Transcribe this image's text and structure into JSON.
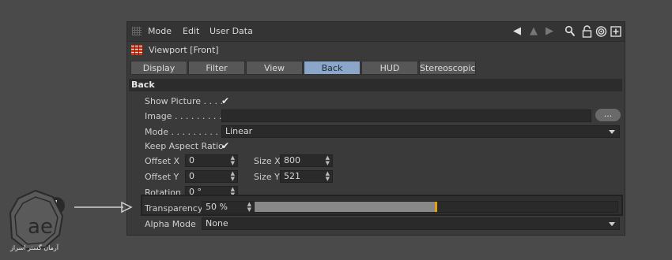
{
  "menubar": {
    "items": [
      "Mode",
      "Edit",
      "User Data"
    ]
  },
  "title": "Viewport [Front]",
  "tabs": [
    "Display",
    "Filter",
    "View",
    "Back",
    "HUD",
    "Stereoscopic"
  ],
  "active_tab": "Back",
  "section": "Back",
  "fields": {
    "show_picture": "Show Picture . . . .",
    "image": "Image . . . . . . . . . .",
    "image_browse": "...",
    "mode": "Mode . . . . . . . . . .",
    "mode_value": "Linear",
    "keep_aspect": "Keep Aspect Ratio",
    "offset_x": "Offset X",
    "offset_x_value": "0",
    "offset_y": "Offset Y",
    "offset_y_value": "0",
    "size_x": "Size X",
    "size_x_value": "800",
    "size_y": "Size Y",
    "size_y_value": "521",
    "rotation": "Rotation",
    "rotation_value": "0 °",
    "transparency": "Transparency",
    "transparency_value": "50 %",
    "transparency_level": 0.5,
    "alpha_mode": "Alpha Mode",
    "alpha_mode_value": "None"
  },
  "checkmark": "✔",
  "callout": "1",
  "watermark": {
    "logo_text": "ae",
    "caption": "آرمان گستر اسراز"
  },
  "colors": {
    "active_tab": "#8aa6c8",
    "slider_knob": "#e8a000"
  },
  "icons": [
    "grip-icon",
    "arrow-left-icon",
    "arrow-up-icon",
    "arrow-right-icon",
    "search-icon",
    "lock-icon",
    "target-icon",
    "new-panel-icon",
    "viewport-icon"
  ]
}
